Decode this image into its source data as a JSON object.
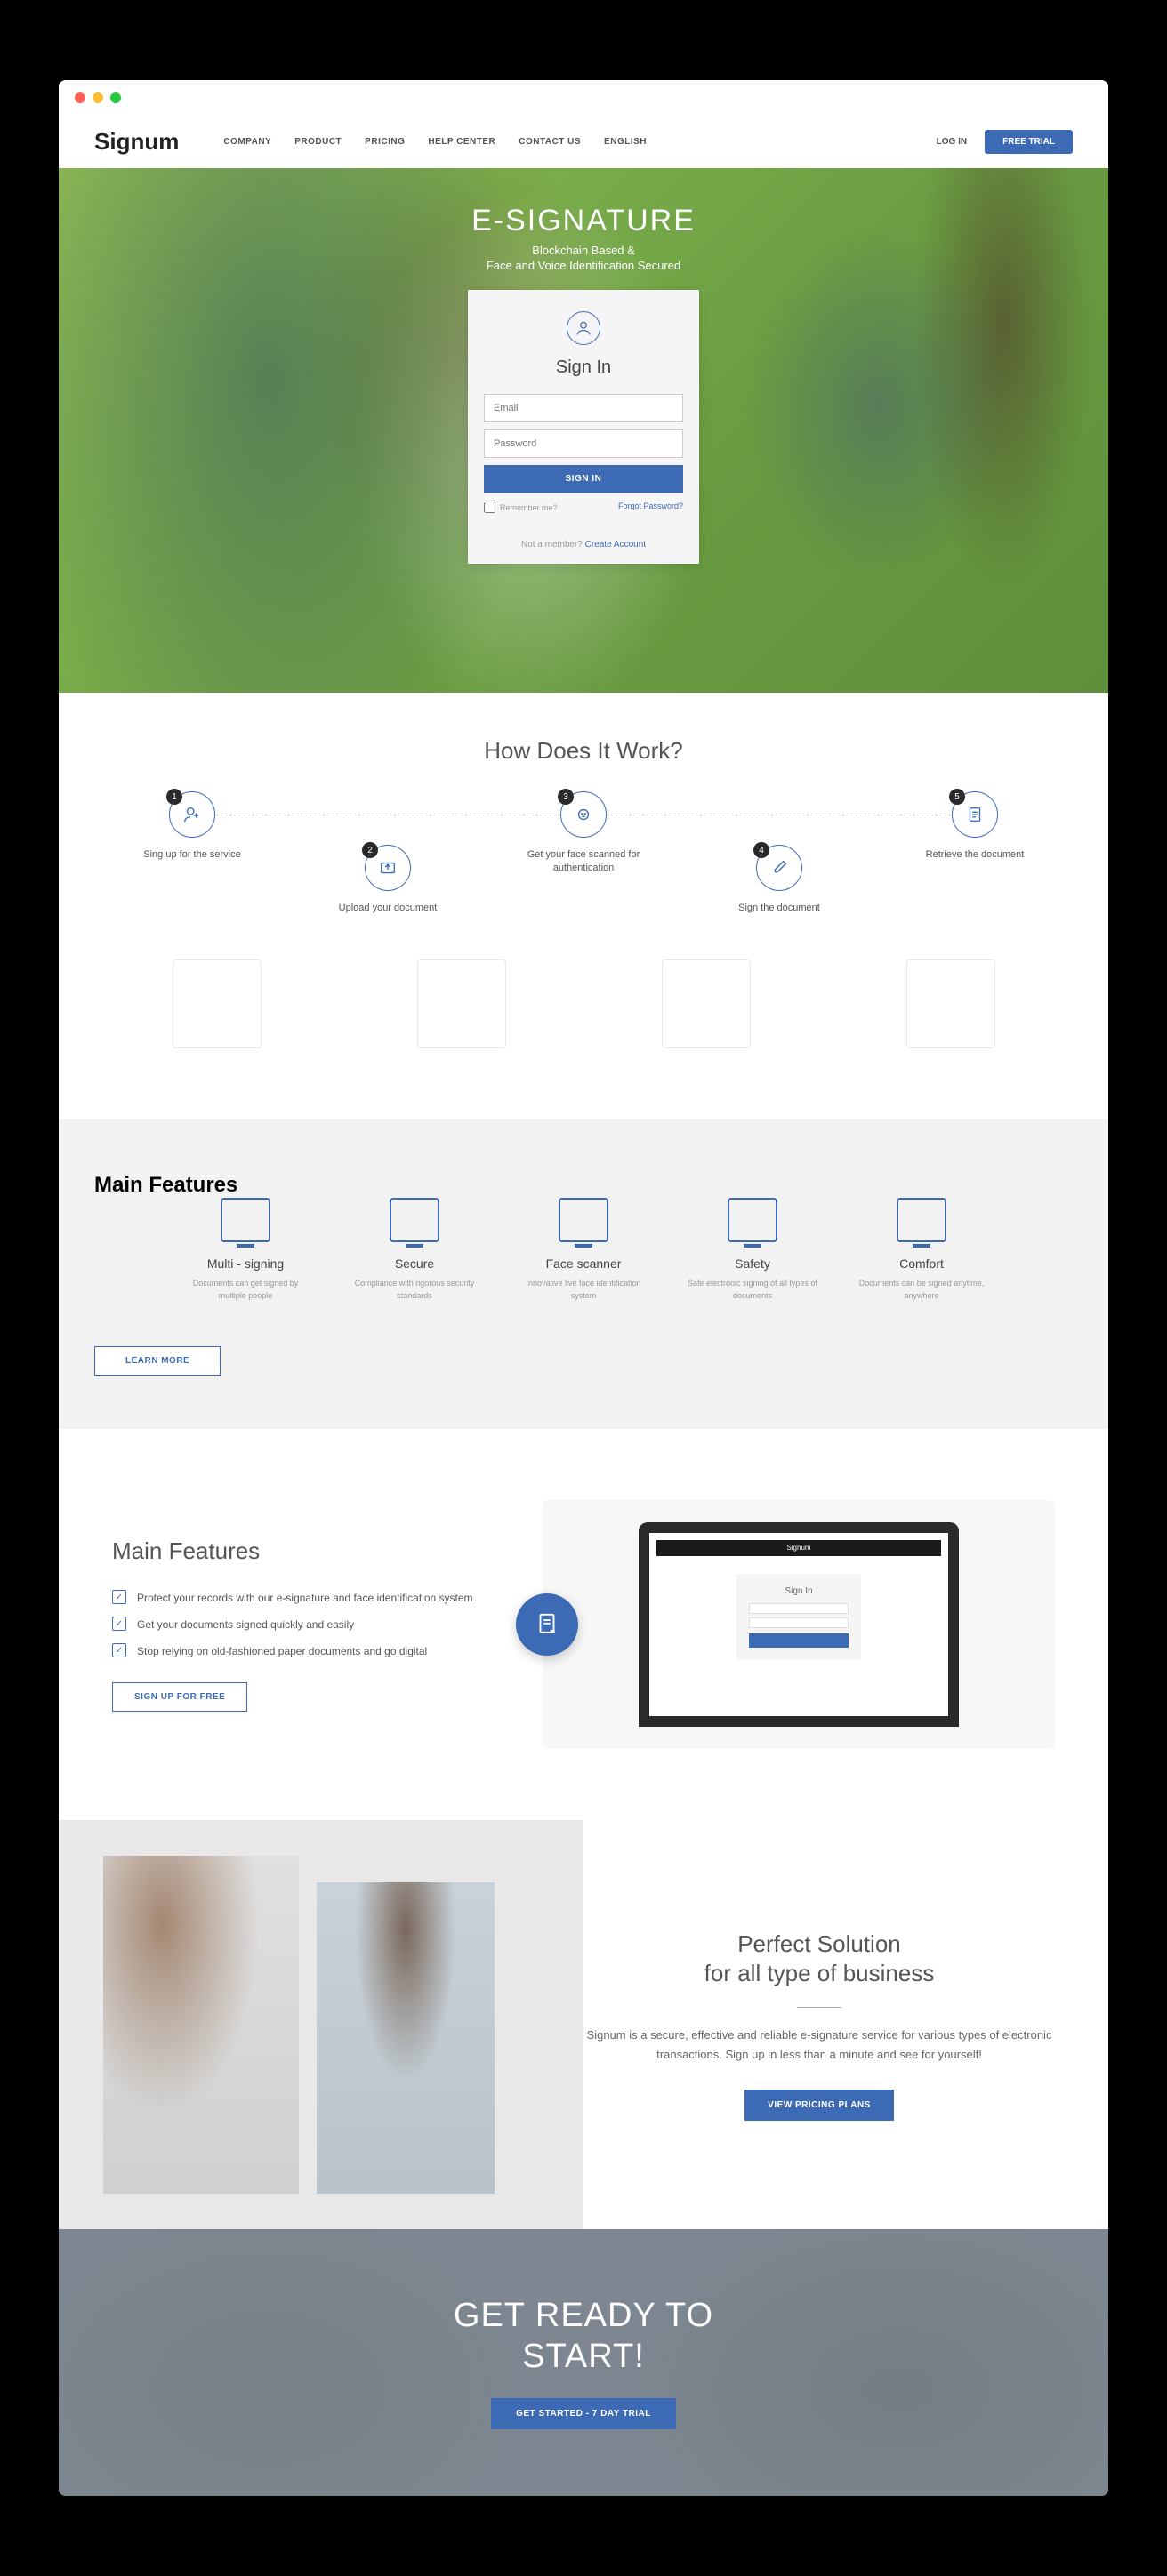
{
  "brand": "Signum",
  "nav": {
    "company": "COMPANY",
    "product": "PRODUCT",
    "pricing": "PRICING",
    "help": "HELP CENTER",
    "contact": "CONTACT US",
    "lang": "ENGLISH"
  },
  "auth": {
    "login": "LOG IN",
    "trial": "FREE TRIAL"
  },
  "hero": {
    "title": "E-SIGNATURE",
    "line1": "Blockchain Based &",
    "line2": "Face and Voice Identification Secured",
    "signin_title": "Sign In",
    "email_ph": "Email",
    "pass_ph": "Password",
    "button": "SIGN IN",
    "remember": "Remember me?",
    "forgot": "Forgot Password?",
    "not_member": "Not a member? ",
    "create": "Create Account"
  },
  "how": {
    "title": "How Does It Work?",
    "s1": "Sing up for the service",
    "s2": "Upload your document",
    "s3": "Get your face scanned for authentication",
    "s4": "Sign the document",
    "s5": "Retrieve the document"
  },
  "features": {
    "title": "Main Features",
    "f1t": "Multi - signing",
    "f1d": "Documents can get signed by multiple people",
    "f2t": "Secure",
    "f2d": "Compliance with rigorous security standards",
    "f3t": "Face scanner",
    "f3d": "Innovative live face identification system",
    "f4t": "Safety",
    "f4d": "Safe electronic signing of all types of documents",
    "f5t": "Comfort",
    "f5d": "Documents can be signed anytime, anywhere",
    "learn": "LEARN MORE"
  },
  "mf2": {
    "title": "Main Features",
    "c1": "Protect your records with our e-signature and face identification system",
    "c2": "Get your documents signed quickly and easily",
    "c3": "Stop relying on old-fashioned paper documents and go digital",
    "signup": "SIGN UP FOR FREE",
    "mini_title": "Sign In"
  },
  "solution": {
    "t1": "Perfect Solution",
    "t2": "for all type of business",
    "desc": "Signum is a secure, effective and reliable e-signature service for various types of electronic transactions. Sign up in less than a minute and see for yourself!",
    "btn": "VIEW PRICING PLANS"
  },
  "cta": {
    "t1": "GET READY TO",
    "t2": "START!",
    "btn": "GET STARTED - 7 DAY TRIAL"
  }
}
